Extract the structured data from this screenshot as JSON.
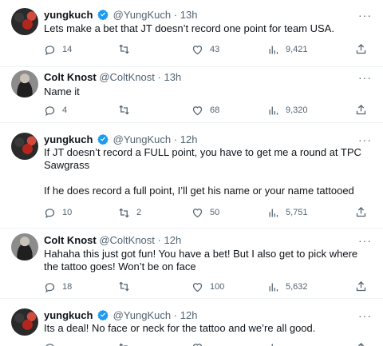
{
  "tweets": [
    {
      "author": "yungkuch",
      "handle": "@YungKuch",
      "time": "13h",
      "verified": true,
      "avatar": "yungkuch-avatar",
      "text": "Lets make a bet that JT doesn’t record one point for team USA.",
      "replies": "14",
      "retweets": "",
      "likes": "43",
      "views": "9,421"
    },
    {
      "author": "Colt Knost",
      "handle": "@ColtKnost",
      "time": "13h",
      "verified": false,
      "avatar": "colt-knost-avatar",
      "text": "Name it",
      "replies": "4",
      "retweets": "",
      "likes": "68",
      "views": "9,320"
    },
    {
      "author": "yungkuch",
      "handle": "@YungKuch",
      "time": "12h",
      "verified": true,
      "avatar": "yungkuch-avatar",
      "text": "If JT doesn’t record a FULL point, you have to get me a round at TPC Sawgrass\n\nIf he does record a full point, I’ll get his name or your name tattooed",
      "replies": "10",
      "retweets": "2",
      "likes": "50",
      "views": "5,751"
    },
    {
      "author": "Colt Knost",
      "handle": "@ColtKnost",
      "time": "12h",
      "verified": false,
      "avatar": "colt-knost-avatar",
      "text": "Hahaha this just got fun!  You have a bet!  But I also get to pick where the tattoo goes!  Won’t be on face",
      "replies": "18",
      "retweets": "",
      "likes": "100",
      "views": "5,632"
    },
    {
      "author": "yungkuch",
      "handle": "@YungKuch",
      "time": "12h",
      "verified": true,
      "avatar": "yungkuch-avatar",
      "text": "Its a deal! No face or neck for the tattoo and we’re all good.",
      "replies": "",
      "retweets": "",
      "likes": "",
      "views": ""
    }
  ],
  "icons": {
    "reply": "reply-icon",
    "retweet": "retweet-icon",
    "like": "heart-icon",
    "views": "views-icon",
    "share": "share-icon",
    "more": "more-icon",
    "verified": "verified-badge-icon"
  },
  "colors": {
    "verified": "#1d9bf0",
    "muted": "#536471",
    "text": "#0f1419"
  }
}
